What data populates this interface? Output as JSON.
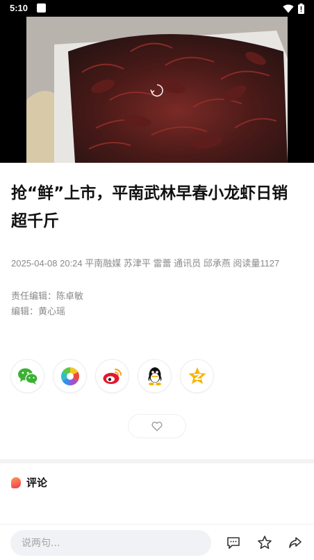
{
  "status_bar": {
    "time": "5:10"
  },
  "article": {
    "title": "抢“鲜”上市，平南武林早春小龙虾日销超千斤",
    "meta": "2025-04-08 20:24 平南融媒 苏津平 雷蕾 通讯员 邱承燕 阅读量1127",
    "editor_in_charge": "责任编辑：陈卓敏",
    "editor": "编辑：黄心瑶"
  },
  "share": {
    "items": [
      {
        "name": "wechat",
        "icon": "wechat-icon",
        "color": "#3cb034"
      },
      {
        "name": "moments",
        "icon": "moments-icon",
        "color": "#f0a22c"
      },
      {
        "name": "weibo",
        "icon": "weibo-icon",
        "color": "#e6162d"
      },
      {
        "name": "qq",
        "icon": "qq-icon",
        "color": "#111111"
      },
      {
        "name": "qzone",
        "icon": "qzone-icon",
        "color": "#f7b500"
      }
    ]
  },
  "comments": {
    "title": "评论"
  },
  "bottom_bar": {
    "placeholder": "说两句..."
  }
}
